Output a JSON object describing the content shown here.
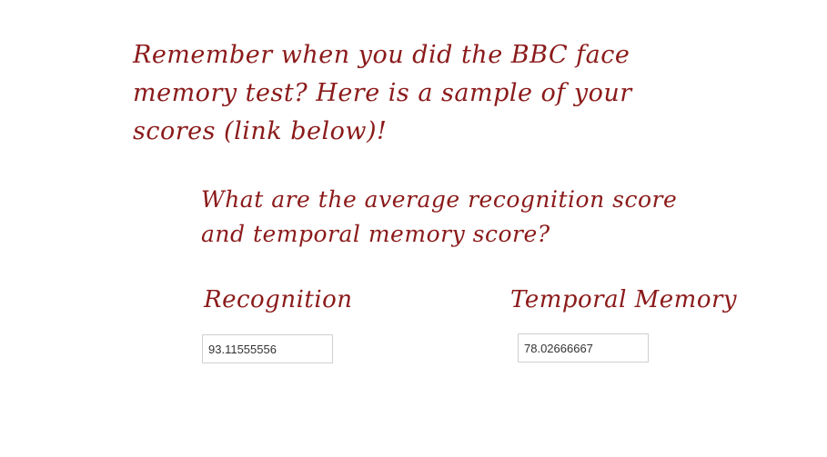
{
  "intro": {
    "text": "Remember when you did the BBC face memory test? Here is a sample of your scores (link below)!"
  },
  "question": {
    "text": "What are the average recognition score and temporal memory score?"
  },
  "answers": {
    "recognition": {
      "label": "Recognition",
      "value": "93.11555556"
    },
    "temporal_memory": {
      "label": "Temporal Memory",
      "value": "78.02666667"
    }
  }
}
